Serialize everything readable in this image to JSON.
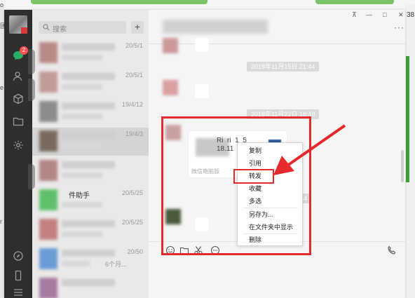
{
  "search": {
    "placeholder": "搜索"
  },
  "nav": {
    "badge": "2"
  },
  "chat_list": [
    {
      "date": "20/5/1"
    },
    {
      "date": "20/5/1"
    },
    {
      "date": "19/4/12"
    },
    {
      "date": "19/4/3"
    },
    {
      "date": ""
    },
    {
      "name_suffix": "件助手",
      "date": "20/5/25"
    },
    {
      "date": "20/5/25"
    },
    {
      "date": "20/50",
      "sub": "6个月..."
    },
    {
      "date": ""
    }
  ],
  "chat": {
    "time_1": "2018年11月15日 21:44",
    "time_2": "2018年11月22日 18:48",
    "time_3": "44",
    "file_text_1": "Ri  ri  1  5",
    "file_text_2": "18.11",
    "file_source": "微信电脑版"
  },
  "context_menu": {
    "items": [
      "复制",
      "引用",
      "转发",
      "收藏",
      "多选",
      "另存为...",
      "在文件夹中显示",
      "删除"
    ]
  },
  "background": {
    "right_number": "38",
    "left_letters": [
      "o",
      "团",
      "e",
      "r"
    ]
  },
  "colors": {
    "annotation": "#e42a2a",
    "nav_bg": "#2e2e2e",
    "badge": "#fa5151",
    "accent_green": "#3f9d3a"
  }
}
